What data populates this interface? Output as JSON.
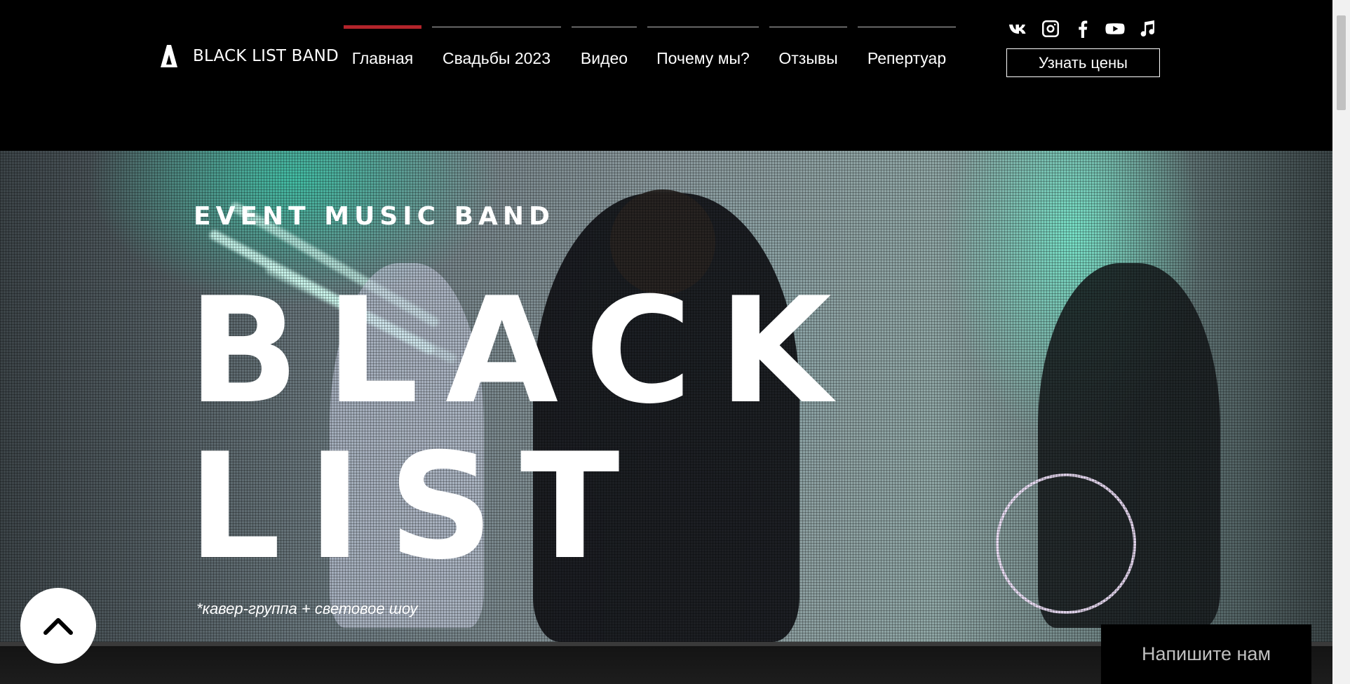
{
  "header": {
    "logo_text": "BLACK LIST BAND",
    "nav": [
      {
        "label": "Главная",
        "active": true
      },
      {
        "label": "Свадьбы 2023",
        "active": false
      },
      {
        "label": "Видео",
        "active": false
      },
      {
        "label": "Почему мы?",
        "active": false
      },
      {
        "label": "Отзывы",
        "active": false
      },
      {
        "label": "Репертуар",
        "active": false
      }
    ],
    "socials": [
      "vk-icon",
      "instagram-icon",
      "facebook-icon",
      "youtube-icon",
      "music-note-icon"
    ],
    "price_button": "Узнать цены"
  },
  "hero": {
    "eyebrow": "EVENT MUSIC BAND",
    "title_line1": "BLACK",
    "title_line2": "LIST",
    "note": "*кавер-группа + световое шоу"
  },
  "widgets": {
    "chat_label": "Напишите нам",
    "scroll_up_icon": "chevron-up-icon"
  },
  "colors": {
    "accent": "#b3242b",
    "background": "#000000",
    "text": "#ffffff"
  }
}
